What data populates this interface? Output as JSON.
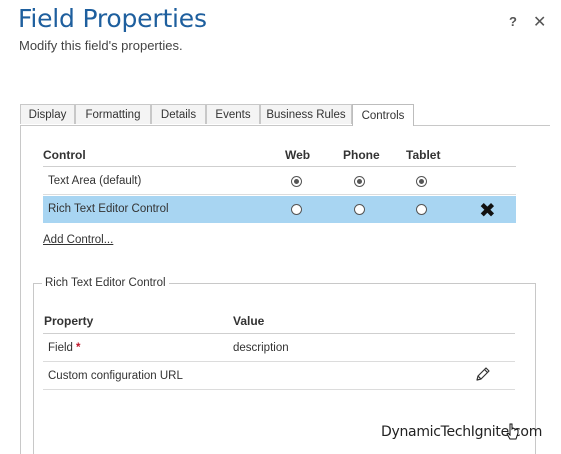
{
  "dialog": {
    "title": "Field Properties",
    "subtitle": "Modify this field's properties.",
    "help_label": "?",
    "close_label": "✕"
  },
  "tabs": [
    {
      "label": "Display"
    },
    {
      "label": "Formatting"
    },
    {
      "label": "Details"
    },
    {
      "label": "Events"
    },
    {
      "label": "Business Rules"
    },
    {
      "label": "Controls",
      "active": true
    }
  ],
  "controls_table": {
    "headers": {
      "control": "Control",
      "web": "Web",
      "phone": "Phone",
      "tablet": "Tablet"
    },
    "rows": [
      {
        "label": "Text Area (default)",
        "web": true,
        "phone": true,
        "tablet": true,
        "selected": false
      },
      {
        "label": "Rich Text Editor Control",
        "web": false,
        "phone": false,
        "tablet": false,
        "selected": true
      }
    ],
    "remove_icon": "✖",
    "add_control_label": "Add Control..."
  },
  "control_properties": {
    "legend": "Rich Text Editor Control",
    "headers": {
      "property": "Property",
      "value": "Value"
    },
    "rows": [
      {
        "property": "Field",
        "required_mark": "*",
        "value": "description"
      },
      {
        "property": "Custom configuration URL",
        "value": ""
      }
    ],
    "edit_icon": "pencil-icon"
  },
  "watermark": "DynamicTechIgnite.com"
}
